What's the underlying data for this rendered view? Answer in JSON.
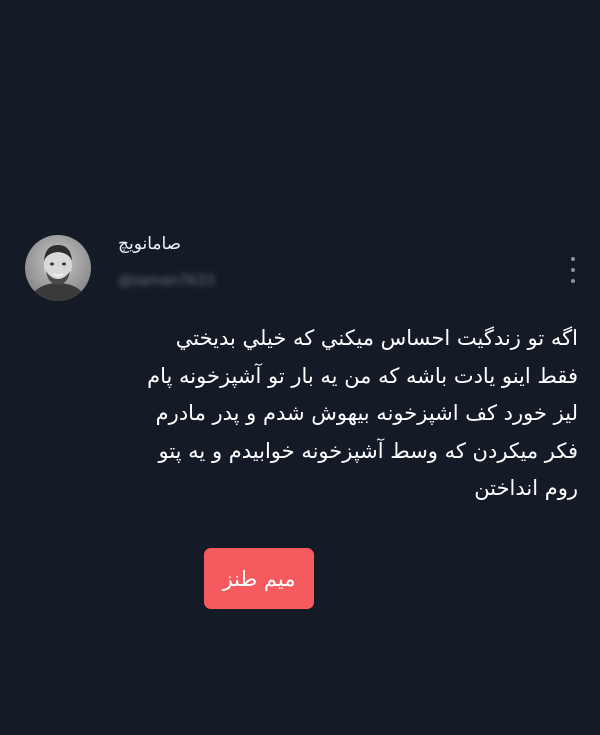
{
  "author": {
    "display_name": "صامانویچ",
    "handle": "@saman7633",
    "avatar_icon": "profile-photo"
  },
  "menu": {
    "icon": "more-vertical-icon"
  },
  "tweet": {
    "lines": [
      "اگه تو زندگیت احساس میکني که خیلي بدیختي",
      "فقط اینو یادت باشه که من یه بار تو آشپزخونه پام",
      "لیز خورد کف اشپزخونه بیهوش شدم و پدر مادرم",
      "فکر میکردن که وسط آشپزخونه خوابیدم و یه پتو",
      "روم انداختن"
    ]
  },
  "tag": {
    "label": "میم طنز",
    "color": "#f55a5e"
  },
  "theme": {
    "background": "#141b26",
    "text": "#ffffff",
    "muted": "#6b7585"
  }
}
